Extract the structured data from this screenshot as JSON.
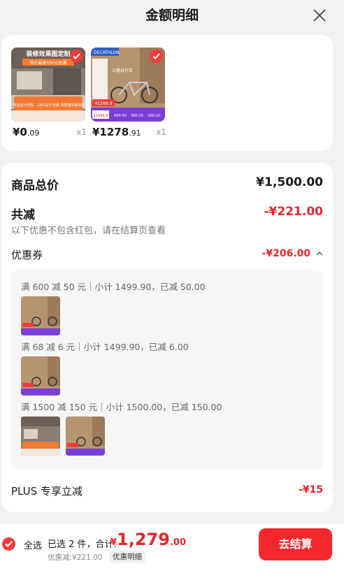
{
  "header": {
    "title": "金额明细"
  },
  "products": [
    {
      "price_int": "¥0",
      "price_dec": ".09",
      "qty": "x1",
      "thumb_title": "装修效果图定制",
      "thumb_sub": "单价最高550元优惠",
      "thumb_tags": [
        "专业设计团队",
        "1对1设计沟通",
        "高质量快速出图"
      ]
    },
    {
      "price_int": "¥1278",
      "price_dec": ".91",
      "qty": "x1",
      "thumb_brand": "DECATHLON",
      "thumb_title": "公路自行车",
      "thumb_price": "¥1299.9",
      "thumb_price2": "¥1449.9",
      "thumb_tags": [
        "600-50",
        "300-20",
        "200-10"
      ]
    }
  ],
  "summary": {
    "total_label": "商品总价",
    "total_value": "¥1,500.00",
    "reduce_label": "共减",
    "reduce_value": "-¥221.00",
    "reduce_note": "以下优惠不包含红包，请在结算页查看",
    "coupon_label": "优惠券",
    "coupon_value": "-¥206.00"
  },
  "coupons": [
    {
      "text": "满 600 减 50 元｜小计 1499.90，已减 50.00"
    },
    {
      "text": "满 68 减 6 元｜小计 1499.90，已减 6.00"
    },
    {
      "text": "满 1500 减 150 元｜小计 1500.00，已减 150.00"
    }
  ],
  "plus": {
    "label": "PLUS 专享立减",
    "value": "-¥15"
  },
  "footer": {
    "select_all": "全选",
    "selected_text": "已选 2 件，合计:",
    "total_prefix": "¥",
    "total_int": "1,279",
    "total_dec": ".00",
    "discount_text": "优惠减:¥221.00",
    "detail_link": "优惠明细",
    "checkout": "去结算"
  },
  "colors": {
    "accent": "#e8262c",
    "button": "#f2282e"
  }
}
